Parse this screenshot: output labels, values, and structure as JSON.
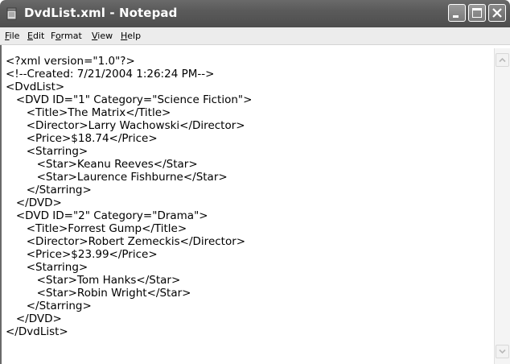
{
  "window": {
    "title": "DvdList.xml - Notepad",
    "icon": "notepad-icon"
  },
  "menu": {
    "file": "File",
    "edit": "Edit",
    "format": "Format",
    "view": "View",
    "help": "Help"
  },
  "editor": {
    "lines": [
      "<?xml version=\"1.0\"?>",
      "<!--Created: 7/21/2004 1:26:24 PM-->",
      "<DvdList>",
      "   <DVD ID=\"1\" Category=\"Science Fiction\">",
      "      <Title>The Matrix</Title>",
      "      <Director>Larry Wachowski</Director>",
      "      <Price>$18.74</Price>",
      "      <Starring>",
      "         <Star>Keanu Reeves</Star>",
      "         <Star>Laurence Fishburne</Star>",
      "      </Starring>",
      "   </DVD>",
      "   <DVD ID=\"2\" Category=\"Drama\">",
      "      <Title>Forrest Gump</Title>",
      "      <Director>Robert Zemeckis</Director>",
      "      <Price>$23.99</Price>",
      "      <Starring>",
      "         <Star>Tom Hanks</Star>",
      "         <Star>Robin Wright</Star>",
      "      </Starring>",
      "   </DVD>",
      "</DvdList>"
    ]
  },
  "colors": {
    "titlebar": "#5a5a5a",
    "text": "#000000",
    "background": "#ffffff"
  }
}
